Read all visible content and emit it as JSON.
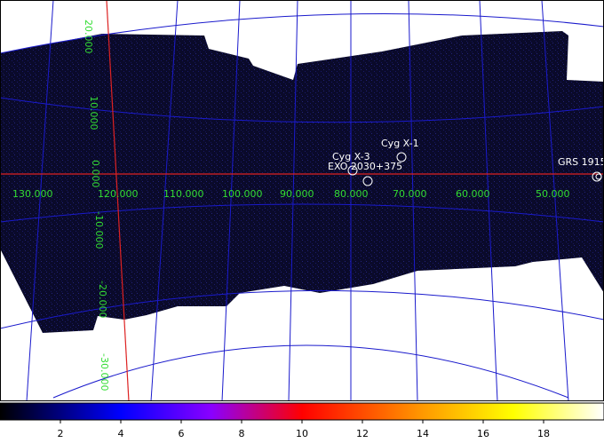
{
  "image": {
    "colormap": "black-blue-purple-red-yellow-white",
    "background_color": "#0a0a2a",
    "grid_color": "#1a1acc",
    "axis_color": "#dd2222",
    "label_color": "#33dd33",
    "source_color": "#ffffff"
  },
  "longitude_labels": [
    "130.000",
    "120.000",
    "110.000",
    "100.000",
    "90.000",
    "80.000",
    "70.000",
    "60.000",
    "50.000"
  ],
  "latitude_labels": [
    "20.000",
    "10.000",
    "0.000",
    "-10.000",
    "-20.000",
    "-30.000"
  ],
  "sources": [
    {
      "name": "Cyg X-1"
    },
    {
      "name": "Cyg X-3"
    },
    {
      "name": "EXO 2030+375"
    },
    {
      "name": "GRS 1915"
    }
  ],
  "colorbar": {
    "ticks": [
      "2",
      "4",
      "6",
      "8",
      "10",
      "12",
      "14",
      "16",
      "18"
    ],
    "min": 0,
    "max": 20
  }
}
